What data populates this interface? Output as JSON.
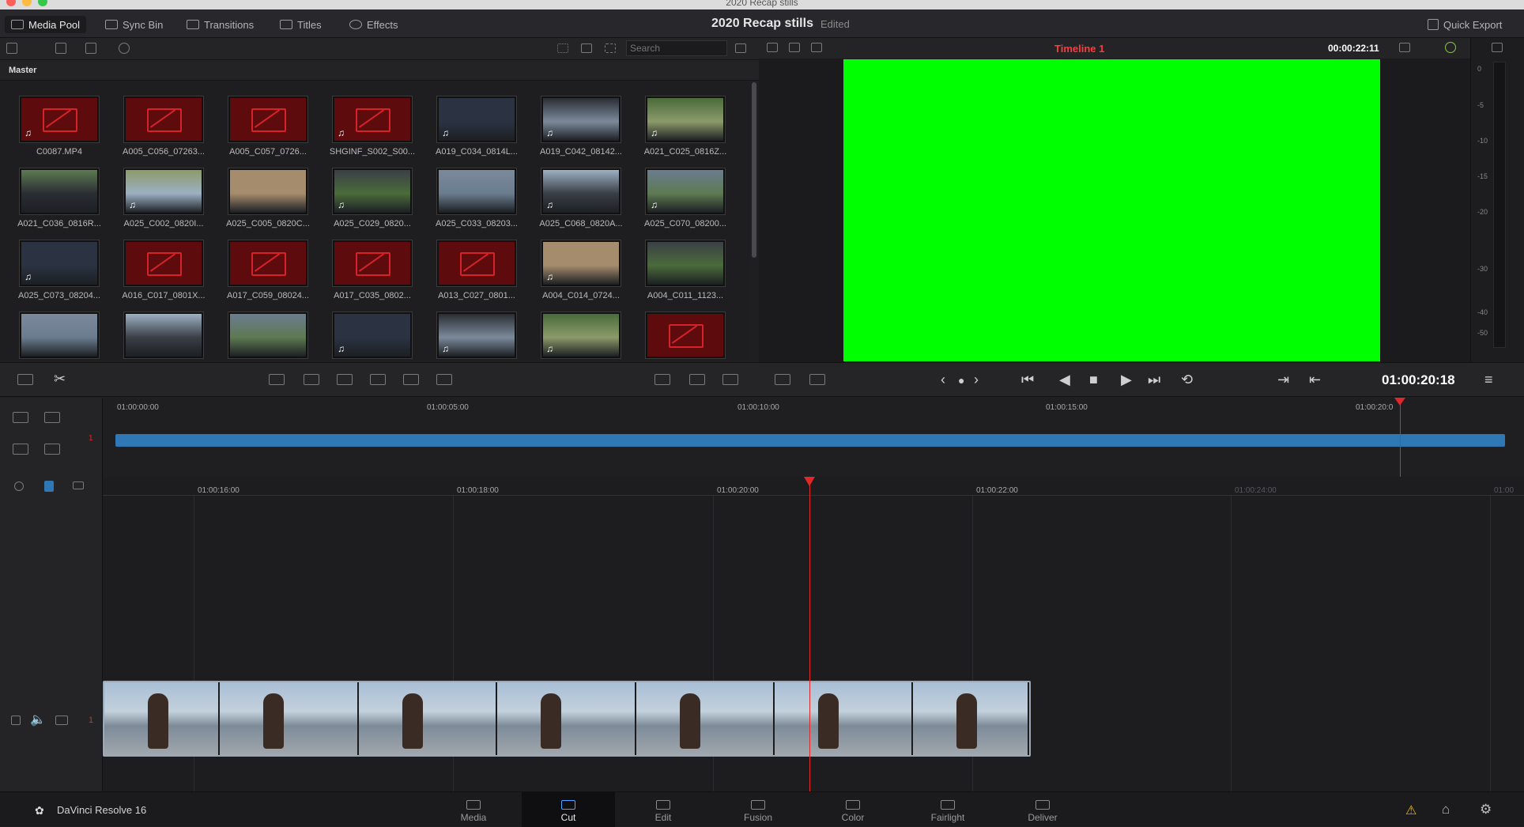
{
  "window": {
    "title": "2020 Recap stills"
  },
  "topbar": {
    "media_pool": "Media Pool",
    "sync_bin": "Sync Bin",
    "transitions": "Transitions",
    "titles": "Titles",
    "effects": "Effects",
    "project_title": "2020 Recap stills",
    "project_status": "Edited",
    "quick_export": "Quick Export"
  },
  "media_pool": {
    "search_placeholder": "Search",
    "bin_title": "Master",
    "clips": [
      {
        "name": "C0087.MP4",
        "offline": true,
        "audio": true
      },
      {
        "name": "A005_C056_07263...",
        "offline": true,
        "audio": false
      },
      {
        "name": "A005_C057_0726...",
        "offline": true,
        "audio": false
      },
      {
        "name": "SHGINF_S002_S00...",
        "offline": true,
        "audio": true
      },
      {
        "name": "A019_C034_0814L...",
        "offline": false,
        "audio": true
      },
      {
        "name": "A019_C042_08142...",
        "offline": false,
        "audio": true
      },
      {
        "name": "A021_C025_0816Z...",
        "offline": false,
        "audio": true
      },
      {
        "name": "A021_C036_0816R...",
        "offline": false,
        "audio": false
      },
      {
        "name": "A025_C002_0820I...",
        "offline": false,
        "audio": true
      },
      {
        "name": "A025_C005_0820C...",
        "offline": false,
        "audio": false
      },
      {
        "name": "A025_C029_0820...",
        "offline": false,
        "audio": true
      },
      {
        "name": "A025_C033_08203...",
        "offline": false,
        "audio": false
      },
      {
        "name": "A025_C068_0820A...",
        "offline": false,
        "audio": true
      },
      {
        "name": "A025_C070_08200...",
        "offline": false,
        "audio": true
      },
      {
        "name": "A025_C073_08204...",
        "offline": false,
        "audio": true
      },
      {
        "name": "A016_C017_0801X...",
        "offline": true,
        "audio": false
      },
      {
        "name": "A017_C059_08024...",
        "offline": true,
        "audio": false
      },
      {
        "name": "A017_C035_0802...",
        "offline": true,
        "audio": false
      },
      {
        "name": "A013_C027_0801...",
        "offline": true,
        "audio": false
      },
      {
        "name": "A004_C014_0724...",
        "offline": false,
        "audio": true
      },
      {
        "name": "A004_C011_1123...",
        "offline": false,
        "audio": false
      },
      {
        "name": "",
        "offline": false,
        "audio": false
      },
      {
        "name": "",
        "offline": false,
        "audio": false
      },
      {
        "name": "",
        "offline": false,
        "audio": false
      },
      {
        "name": "",
        "offline": false,
        "audio": true
      },
      {
        "name": "",
        "offline": false,
        "audio": true
      },
      {
        "name": "",
        "offline": false,
        "audio": true
      },
      {
        "name": "",
        "offline": true,
        "audio": false
      }
    ]
  },
  "viewer": {
    "timeline_name": "Timeline 1",
    "timecode_top": "00:00:22:11",
    "timecode_main": "01:00:20:18",
    "meter_scale": [
      "0",
      "-5",
      "-10",
      "-15",
      "-20",
      "-30",
      "-40",
      "-50"
    ]
  },
  "upper_timeline": {
    "track_number": "1",
    "ruler": [
      "01:00:00:00",
      "01:00:05:00",
      "01:00:10:00",
      "01:00:15:00",
      "01:00:20:0"
    ]
  },
  "lower_timeline": {
    "track_number": "1",
    "ruler": [
      "01:00:16:00",
      "01:00:18:00",
      "01:00:20:00",
      "01:00:22:00",
      "01:00:24:00",
      "01:00"
    ]
  },
  "bottom": {
    "brand": "DaVinci Resolve 16",
    "pages": [
      "Media",
      "Cut",
      "Edit",
      "Fusion",
      "Color",
      "Fairlight",
      "Deliver"
    ],
    "active_page": "Cut"
  },
  "colors": {
    "accent": "#2f77b5",
    "playhead": "#e02828",
    "viewer_frame": "#00ff00"
  }
}
